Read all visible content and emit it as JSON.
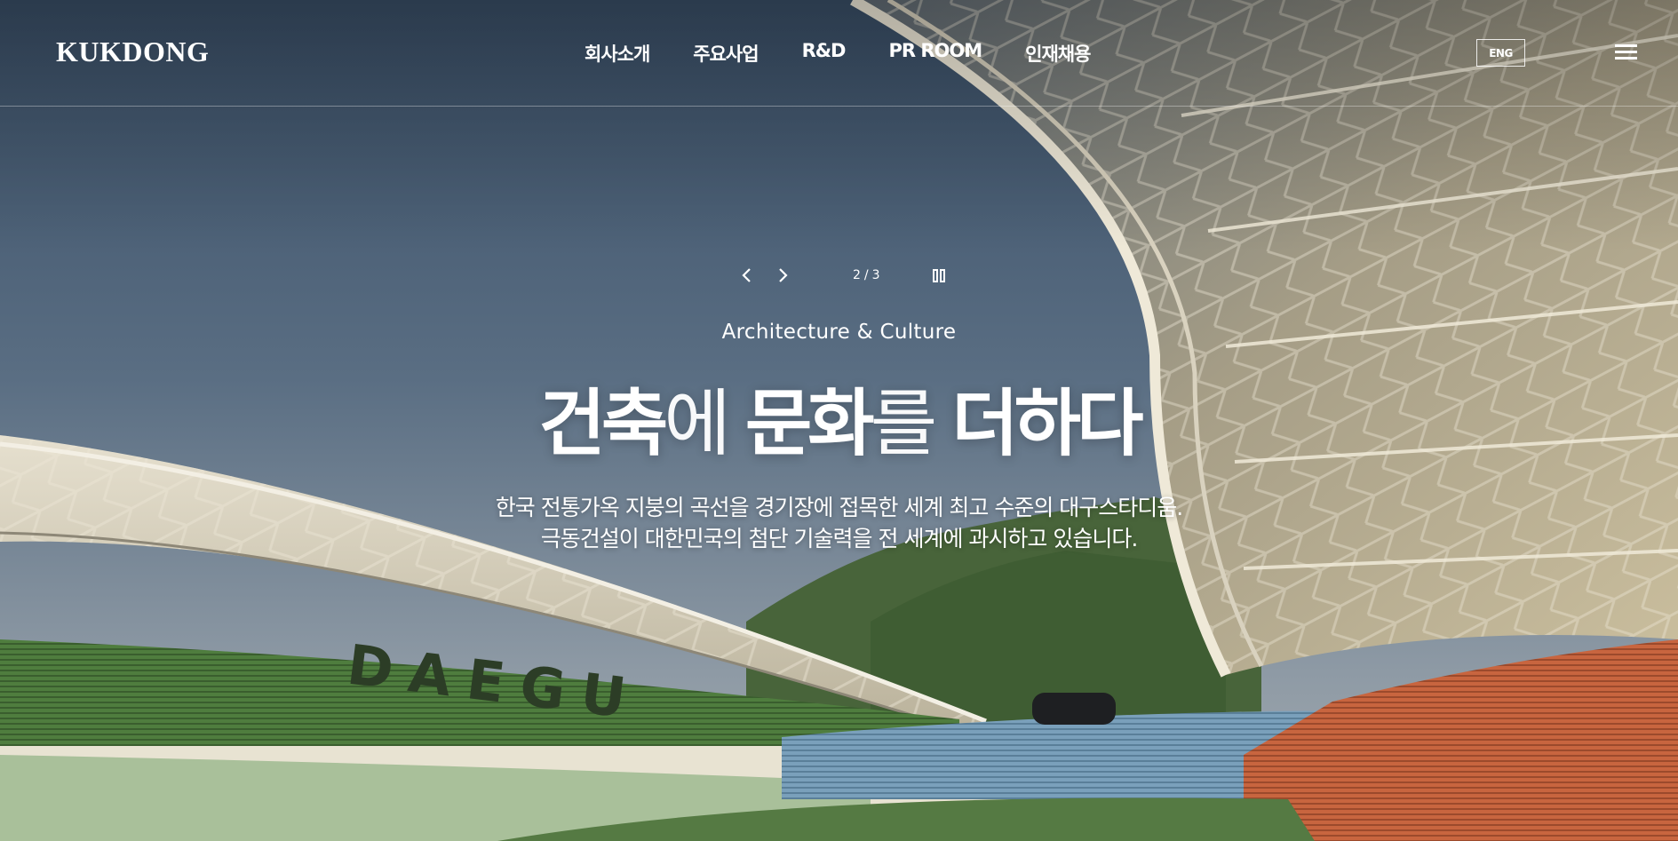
{
  "brand": {
    "logo_text": "KUKDONG"
  },
  "nav": {
    "items": [
      {
        "label": "회사소개"
      },
      {
        "label": "주요사업"
      },
      {
        "label": "R&D"
      },
      {
        "label": "PR ROOM"
      },
      {
        "label": "인재채용"
      }
    ],
    "lang_label": "ENG",
    "menu_icon": "hamburger-menu-icon"
  },
  "slider": {
    "current": "2",
    "separator": "/",
    "total": "3",
    "prev_icon": "chevron-left-icon",
    "next_icon": "chevron-right-icon",
    "pause_icon": "pause-icon"
  },
  "hero": {
    "eyebrow": "Architecture & Culture",
    "headline": {
      "part1": "건축",
      "part2": "에 ",
      "part3": "문화",
      "part4": "를 ",
      "part5": "더하다"
    },
    "desc_line1": "한국 전통가옥 지붕의 곡선을 경기장에 접목한 세계 최고 수준의 대구스타디움.",
    "desc_line2": "극동건설이 대한민국의 첨단 기술력을 전 세계에 과시하고 있습니다.",
    "stadium_seat_lettering": "DAEGU"
  },
  "colors": {
    "sky_top": "#3b5068",
    "sky_bottom": "#8e9aa5",
    "seat_green": "#4f7d3e",
    "seat_blue": "#6f97b5",
    "seat_orange": "#c2603b",
    "hill_green": "#48643a",
    "roof_cream": "#cfc7b2"
  }
}
